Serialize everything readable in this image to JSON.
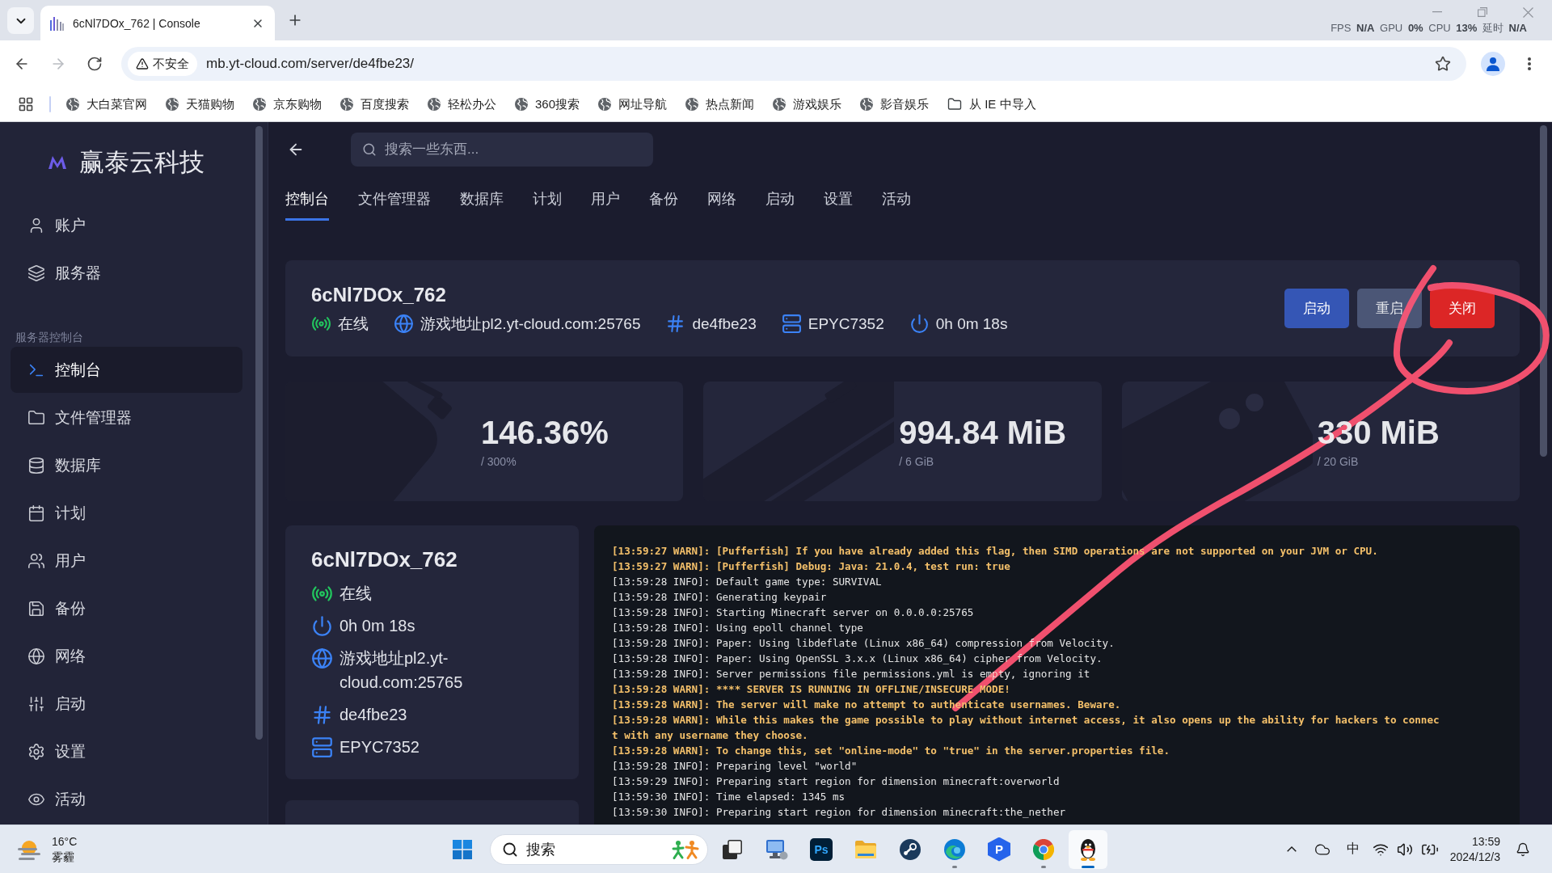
{
  "browser": {
    "tabs": [
      {
        "title": "6cNl7DOx_762 | Console",
        "selected": true
      }
    ],
    "performance_overlay": "FPS **N/A** GPU **0%** CPU **13%** 延时 **N/A**",
    "nav_buttons": [
      {
        "kind": "back",
        "disabled": false
      },
      {
        "kind": "forward",
        "disabled": true
      },
      {
        "kind": "reload",
        "disabled": false
      }
    ],
    "address_bar": {
      "security_label": "不安全",
      "url": "mb.yt-cloud.com/server/de4fbe23/"
    },
    "bookmarks": [
      {
        "kind": "site",
        "label": "大白菜官网"
      },
      {
        "kind": "site",
        "label": "天猫购物"
      },
      {
        "kind": "site",
        "label": "京东购物"
      },
      {
        "kind": "site",
        "label": "百度搜索"
      },
      {
        "kind": "site",
        "label": "轻松办公"
      },
      {
        "kind": "site",
        "label": "360搜索"
      },
      {
        "kind": "site",
        "label": "网址导航"
      },
      {
        "kind": "site",
        "label": "热点新闻"
      },
      {
        "kind": "site",
        "label": "游戏娱乐"
      },
      {
        "kind": "site",
        "label": "影音娱乐"
      },
      {
        "kind": "folder",
        "label": "从 IE 中导入"
      }
    ]
  },
  "sidebar": {
    "brand": "赢泰云科技",
    "items": [
      {
        "label": "账户",
        "selected": false
      },
      {
        "label": "服务器",
        "selected": false
      }
    ],
    "section": {
      "title": "服务器控制台",
      "items": [
        {
          "label": "控制台",
          "selected": true
        },
        {
          "label": "文件管理器",
          "selected": false
        },
        {
          "label": "数据库",
          "selected": false
        },
        {
          "label": "计划",
          "selected": false
        },
        {
          "label": "用户",
          "selected": false
        },
        {
          "label": "备份",
          "selected": false
        },
        {
          "label": "网络",
          "selected": false
        },
        {
          "label": "启动",
          "selected": false
        },
        {
          "label": "设置",
          "selected": false
        },
        {
          "label": "活动",
          "selected": false
        }
      ]
    }
  },
  "main": {
    "search": {
      "placeholder": "搜索一些东西..."
    },
    "tabs": [
      {
        "label": "控制台",
        "selected": true
      },
      {
        "label": "文件管理器",
        "selected": false
      },
      {
        "label": "数据库",
        "selected": false
      },
      {
        "label": "计划",
        "selected": false
      },
      {
        "label": "用户",
        "selected": false
      },
      {
        "label": "备份",
        "selected": false
      },
      {
        "label": "网络",
        "selected": false
      },
      {
        "label": "启动",
        "selected": false
      },
      {
        "label": "设置",
        "selected": false
      },
      {
        "label": "活动",
        "selected": false
      }
    ],
    "server_header": {
      "name": "6cNl7DOx_762",
      "info": [
        {
          "kind": "status",
          "text": "在线",
          "online": true
        },
        {
          "kind": "address",
          "text": "游戏地址pl2.yt-cloud.com:25765"
        },
        {
          "kind": "id",
          "text": "de4fbe23"
        },
        {
          "kind": "node",
          "text": "EPYC7352"
        },
        {
          "kind": "uptime",
          "text": "0h 0m 18s"
        }
      ],
      "buttons": [
        {
          "kind": "start",
          "label": "启动"
        },
        {
          "kind": "restart",
          "label": "重启"
        },
        {
          "kind": "stop",
          "label": "关闭"
        }
      ]
    },
    "stats": [
      {
        "kind": "cpu",
        "value": "146.36%",
        "limit": "/ 300%"
      },
      {
        "kind": "memory",
        "value": "994.84 MiB",
        "limit": "/ 6 GiB"
      },
      {
        "kind": "disk",
        "value": "330 MiB",
        "limit": "/ 20 GiB"
      }
    ],
    "details_card": {
      "name": "6cNl7DOx_762",
      "info": [
        {
          "kind": "status",
          "text": "在线",
          "online": true
        },
        {
          "kind": "uptime",
          "text": "0h 0m 18s"
        },
        {
          "kind": "address",
          "text": "游戏地址pl2.yt-cloud.com:25765"
        },
        {
          "kind": "id",
          "text": "de4fbe23"
        },
        {
          "kind": "node",
          "text": "EPYC7352"
        }
      ]
    },
    "console": {
      "lines": [
        {
          "kind": "warn",
          "text": "[13:59:27 WARN]: [Pufferfish] If you have already added this flag, then SIMD operations are not supported on your JVM or CPU."
        },
        {
          "kind": "warn",
          "text": "[13:59:27 WARN]: [Pufferfish] Debug: Java: 21.0.4, test run: true"
        },
        {
          "kind": "info",
          "text": "[13:59:28 INFO]: Default game type: SURVIVAL"
        },
        {
          "kind": "info",
          "text": "[13:59:28 INFO]: Generating keypair"
        },
        {
          "kind": "info",
          "text": "[13:59:28 INFO]: Starting Minecraft server on 0.0.0.0:25765"
        },
        {
          "kind": "info",
          "text": "[13:59:28 INFO]: Using epoll channel type"
        },
        {
          "kind": "info",
          "text": "[13:59:28 INFO]: Paper: Using libdeflate (Linux x86_64) compression from Velocity."
        },
        {
          "kind": "info",
          "text": "[13:59:28 INFO]: Paper: Using OpenSSL 3.x.x (Linux x86_64) cipher from Velocity."
        },
        {
          "kind": "info",
          "text": "[13:59:28 INFO]: Server permissions file permissions.yml is empty, ignoring it"
        },
        {
          "kind": "warn",
          "text": "[13:59:28 WARN]: **** SERVER IS RUNNING IN OFFLINE/INSECURE MODE!"
        },
        {
          "kind": "warn",
          "text": "[13:59:28 WARN]: The server will make no attempt to authenticate usernames. Beware."
        },
        {
          "kind": "warn",
          "text": "[13:59:28 WARN]: While this makes the game possible to play without internet access, it also opens up the ability for hackers to connect with any username they choose."
        },
        {
          "kind": "warn",
          "text": "[13:59:28 WARN]: To change this, set \"online-mode\" to \"true\" in the server.properties file."
        },
        {
          "kind": "info",
          "text": "[13:59:28 INFO]: Preparing level \"world\""
        },
        {
          "kind": "info",
          "text": "[13:59:29 INFO]: Preparing start region for dimension minecraft:overworld"
        },
        {
          "kind": "info",
          "text": "[13:59:30 INFO]: Time elapsed: 1345 ms"
        },
        {
          "kind": "info",
          "text": "[13:59:30 INFO]: Preparing start region for dimension minecraft:the_nether"
        }
      ]
    }
  },
  "taskbar": {
    "weather": {
      "temperature": "16°C",
      "condition": "雾霾"
    },
    "search": {
      "label": "搜索"
    },
    "apps": [
      {
        "selected": false,
        "running": false
      },
      {
        "selected": false,
        "running": false
      },
      {
        "label": "Ps",
        "selected": false,
        "running": false
      },
      {
        "selected": false,
        "running": false
      },
      {
        "selected": false,
        "running": false
      },
      {
        "selected": false,
        "running": true
      },
      {
        "label": "P",
        "selected": false,
        "running": false
      },
      {
        "selected": false,
        "running": true
      },
      {
        "selected": true,
        "running": true
      }
    ],
    "tray": {
      "ime": "中",
      "time": "13:59",
      "date": "2024/12/3"
    }
  }
}
